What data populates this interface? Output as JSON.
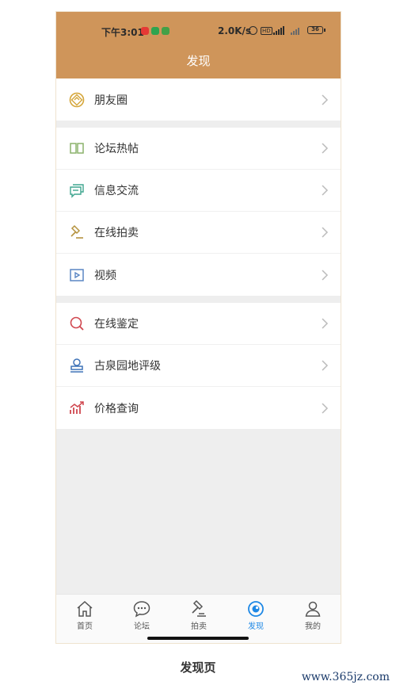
{
  "status_bar": {
    "time": "下午3:01",
    "network_speed": "2.0K/s",
    "battery": "36"
  },
  "header": {
    "title": "发现"
  },
  "groups": [
    [
      {
        "label": "朋友圈",
        "icon": "moments-icon"
      }
    ],
    [
      {
        "label": "论坛热帖",
        "icon": "book-icon"
      },
      {
        "label": "信息交流",
        "icon": "chat-icon"
      },
      {
        "label": "在线拍卖",
        "icon": "gavel-icon"
      },
      {
        "label": "视频",
        "icon": "video-icon"
      }
    ],
    [
      {
        "label": "在线鉴定",
        "icon": "search-icon"
      },
      {
        "label": "古泉园地评级",
        "icon": "stamp-icon"
      },
      {
        "label": "价格查询",
        "icon": "chart-icon"
      }
    ]
  ],
  "tabs": [
    {
      "label": "首页",
      "icon": "home-icon"
    },
    {
      "label": "论坛",
      "icon": "chat-bubble-icon"
    },
    {
      "label": "拍卖",
      "icon": "gavel-icon"
    },
    {
      "label": "发现",
      "icon": "discover-icon",
      "active": true
    },
    {
      "label": "我的",
      "icon": "person-icon"
    }
  ],
  "colors": {
    "header_bg": "#cf955a",
    "active_tab": "#1e88e5"
  },
  "caption": "发现页",
  "watermark": "www.365jz.com"
}
